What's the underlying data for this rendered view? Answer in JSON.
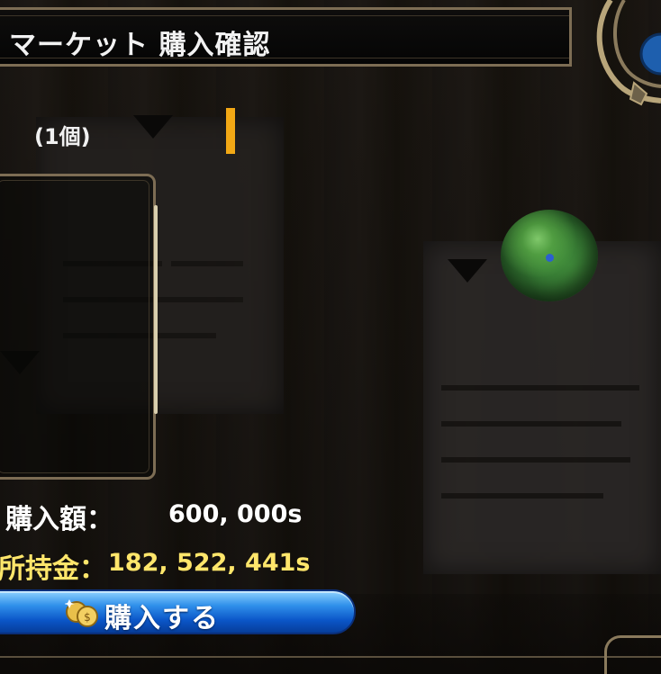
{
  "header": {
    "title": "マーケット 購入確認"
  },
  "item": {
    "quantity": "(1個)"
  },
  "purchase": {
    "price_label": "購入額：",
    "price_value": "600, 000s",
    "money_label": "所持金：",
    "money_value": "182, 522, 441s"
  },
  "buy_button": {
    "label": "購入する",
    "icon": "coin-icon"
  },
  "colors": {
    "accent_orange": "#f2a815",
    "money_yellow": "#ffe66b",
    "button_blue": "#2f8fea",
    "frame_gold": "#7d6d54"
  }
}
